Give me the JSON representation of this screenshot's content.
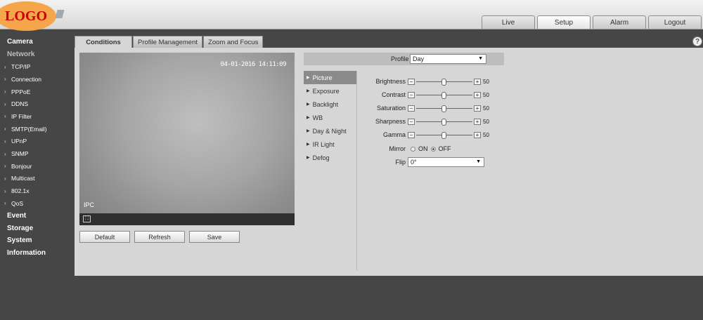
{
  "logo": {
    "text": "LOGO"
  },
  "top_tabs": [
    "Live",
    "Setup",
    "Alarm",
    "Logout"
  ],
  "active_top_tab": "Setup",
  "sidebar": {
    "items": [
      {
        "label": "Camera",
        "type": "section"
      },
      {
        "label": "Network",
        "type": "section-open"
      },
      {
        "label": "TCP/IP",
        "type": "sub"
      },
      {
        "label": "Connection",
        "type": "sub"
      },
      {
        "label": "PPPoE",
        "type": "sub"
      },
      {
        "label": "DDNS",
        "type": "sub"
      },
      {
        "label": "IP Filter",
        "type": "sub"
      },
      {
        "label": "SMTP(Email)",
        "type": "sub"
      },
      {
        "label": "UPnP",
        "type": "sub"
      },
      {
        "label": "SNMP",
        "type": "sub"
      },
      {
        "label": "Bonjour",
        "type": "sub"
      },
      {
        "label": "Multicast",
        "type": "sub"
      },
      {
        "label": "802.1x",
        "type": "sub"
      },
      {
        "label": "QoS",
        "type": "sub"
      },
      {
        "label": "Event",
        "type": "section"
      },
      {
        "label": "Storage",
        "type": "section"
      },
      {
        "label": "System",
        "type": "section"
      },
      {
        "label": "Information",
        "type": "section"
      }
    ]
  },
  "tabs": [
    "Conditions",
    "Profile Management",
    "Zoom and Focus"
  ],
  "active_tab": "Conditions",
  "help_icon": "?",
  "video": {
    "timestamp": "04-01-2016 14:11:09",
    "channel": "IPC"
  },
  "buttons": {
    "default": "Default",
    "refresh": "Refresh",
    "save": "Save"
  },
  "profile": {
    "label": "Profile",
    "value": "Day"
  },
  "submenu": [
    "Picture",
    "Exposure",
    "Backlight",
    "WB",
    "Day & Night",
    "IR Light",
    "Defog"
  ],
  "active_submenu": "Picture",
  "sliders": [
    {
      "label": "Brightness",
      "value": "50"
    },
    {
      "label": "Contrast",
      "value": "50"
    },
    {
      "label": "Saturation",
      "value": "50"
    },
    {
      "label": "Sharpness",
      "value": "50"
    },
    {
      "label": "Gamma",
      "value": "50"
    }
  ],
  "mirror": {
    "label": "Mirror",
    "on_label": "ON",
    "off_label": "OFF",
    "selected": "OFF"
  },
  "flip": {
    "label": "Flip",
    "value": "0°"
  }
}
